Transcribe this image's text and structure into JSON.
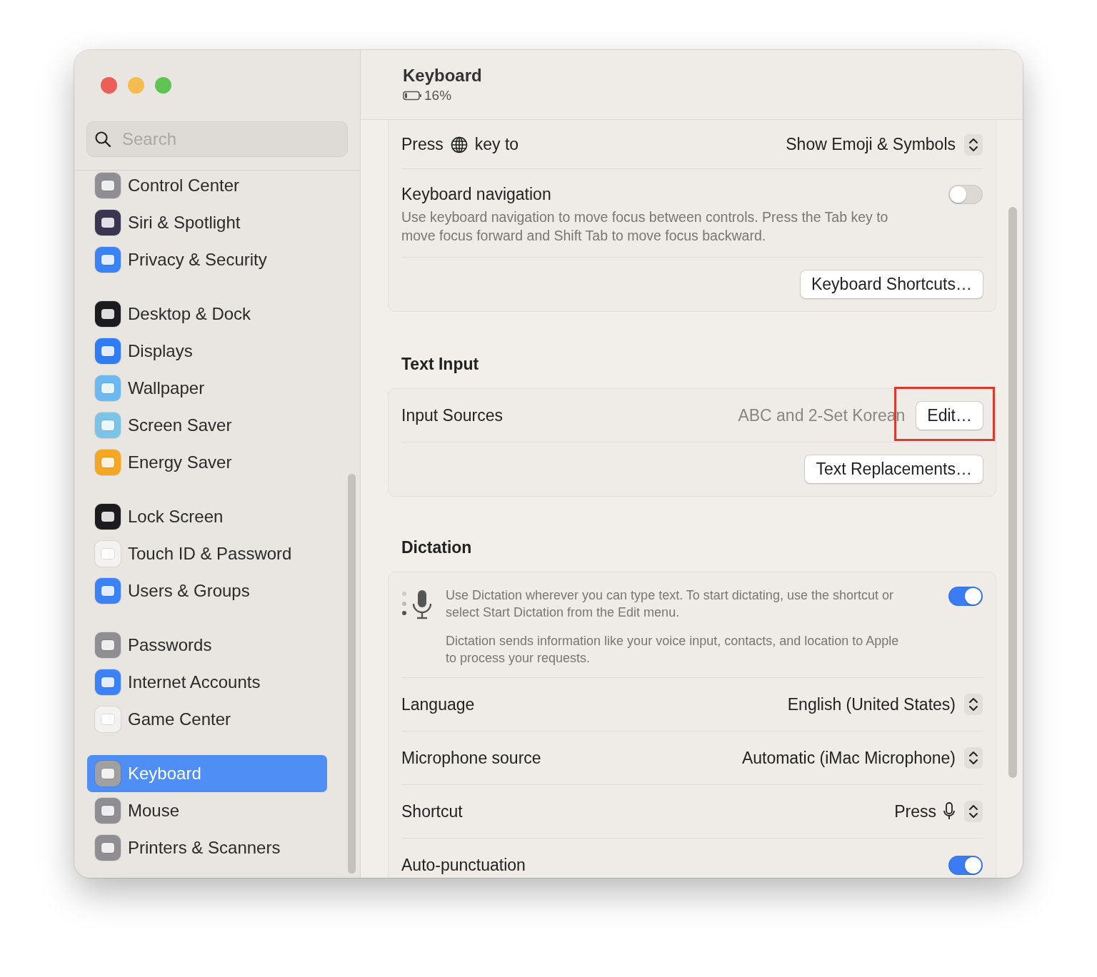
{
  "sidebar": {
    "search": {
      "placeholder": "Search"
    },
    "groups": [
      {
        "items": [
          {
            "label": "Control Center",
            "color": "#8e8e93",
            "selected": false
          },
          {
            "label": "Siri & Spotlight",
            "color": "#3a3550",
            "selected": false
          },
          {
            "label": "Privacy & Security",
            "color": "#3b82f6",
            "selected": false
          }
        ]
      },
      {
        "items": [
          {
            "label": "Desktop & Dock",
            "color": "#1c1c1e",
            "selected": false
          },
          {
            "label": "Displays",
            "color": "#2f7cf6",
            "selected": false
          },
          {
            "label": "Wallpaper",
            "color": "#6cb8f0",
            "selected": false
          },
          {
            "label": "Screen Saver",
            "color": "#7cc3e8",
            "selected": false
          },
          {
            "label": "Energy Saver",
            "color": "#f5a623",
            "selected": false
          }
        ]
      },
      {
        "items": [
          {
            "label": "Lock Screen",
            "color": "#1c1c1e",
            "selected": false
          },
          {
            "label": "Touch ID & Password",
            "color": "#f4f2f0",
            "selected": false
          },
          {
            "label": "Users & Groups",
            "color": "#3b82f6",
            "selected": false
          }
        ]
      },
      {
        "items": [
          {
            "label": "Passwords",
            "color": "#8e8e93",
            "selected": false
          },
          {
            "label": "Internet Accounts",
            "color": "#3b82f6",
            "selected": false
          },
          {
            "label": "Game Center",
            "color": "#f4f2f0",
            "selected": false
          }
        ]
      },
      {
        "items": [
          {
            "label": "Keyboard",
            "color": "#a0a0a0",
            "selected": true
          },
          {
            "label": "Mouse",
            "color": "#8e8e93",
            "selected": false
          },
          {
            "label": "Printers & Scanners",
            "color": "#8e8e93",
            "selected": false
          }
        ]
      }
    ]
  },
  "header": {
    "title": "Keyboard",
    "battery": "16%"
  },
  "keyboard_card": {
    "press_key": {
      "before": "Press",
      "after": "key to",
      "value": "Show Emoji & Symbols"
    },
    "navigation": {
      "title": "Keyboard navigation",
      "description": "Use keyboard navigation to move focus between controls. Press the Tab key to move focus forward and Shift Tab to move focus backward.",
      "on": false
    },
    "button": "Keyboard Shortcuts…"
  },
  "text_input": {
    "heading": "Text Input",
    "input_sources": {
      "label": "Input Sources",
      "value": "ABC and 2-Set Korean",
      "button": {
        "label": "Edit…",
        "highlighted": true
      }
    },
    "button": "Text Replacements…"
  },
  "dictation": {
    "heading": "Dictation",
    "description": "Use Dictation wherever you can type text. To start dictating, use the shortcut or select Start Dictation from the Edit menu.",
    "privacy_note": "Dictation sends information like your voice input, contacts, and location to Apple to process your requests.",
    "on": true,
    "rows": [
      {
        "kind": "popup",
        "label": "Language",
        "value": "English (United States)"
      },
      {
        "kind": "popup",
        "label": "Microphone source",
        "value": "Automatic (iMac Microphone)"
      },
      {
        "kind": "shortcut",
        "label": "Shortcut",
        "value": "Press"
      },
      {
        "kind": "toggle",
        "label": "Auto-punctuation",
        "on": true
      }
    ]
  }
}
